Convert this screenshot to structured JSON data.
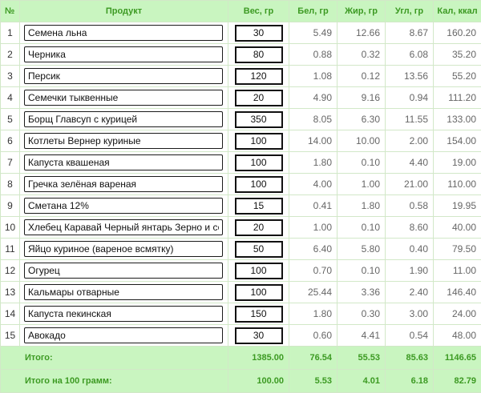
{
  "headers": {
    "num": "№",
    "product": "Продукт",
    "weight": "Вес, гр",
    "protein": "Бел, гр",
    "fat": "Жир, гр",
    "carbs": "Угл, гр",
    "kcal": "Кал, ккал"
  },
  "rows": [
    {
      "n": "1",
      "name": "Семена льна",
      "weight": "30",
      "protein": "5.49",
      "fat": "12.66",
      "carbs": "8.67",
      "kcal": "160.20"
    },
    {
      "n": "2",
      "name": "Черника",
      "weight": "80",
      "protein": "0.88",
      "fat": "0.32",
      "carbs": "6.08",
      "kcal": "35.20"
    },
    {
      "n": "3",
      "name": "Персик",
      "weight": "120",
      "protein": "1.08",
      "fat": "0.12",
      "carbs": "13.56",
      "kcal": "55.20"
    },
    {
      "n": "4",
      "name": "Семечки тыквенные",
      "weight": "20",
      "protein": "4.90",
      "fat": "9.16",
      "carbs": "0.94",
      "kcal": "111.20"
    },
    {
      "n": "5",
      "name": "Борщ Главсуп с курицей",
      "weight": "350",
      "protein": "8.05",
      "fat": "6.30",
      "carbs": "11.55",
      "kcal": "133.00"
    },
    {
      "n": "6",
      "name": "Котлеты Вернер куриные",
      "weight": "100",
      "protein": "14.00",
      "fat": "10.00",
      "carbs": "2.00",
      "kcal": "154.00"
    },
    {
      "n": "7",
      "name": "Капуста квашеная",
      "weight": "100",
      "protein": "1.80",
      "fat": "0.10",
      "carbs": "4.40",
      "kcal": "19.00"
    },
    {
      "n": "8",
      "name": "Гречка зелёная вареная",
      "weight": "100",
      "protein": "4.00",
      "fat": "1.00",
      "carbs": "21.00",
      "kcal": "110.00"
    },
    {
      "n": "9",
      "name": "Сметана 12%",
      "weight": "15",
      "protein": "0.41",
      "fat": "1.80",
      "carbs": "0.58",
      "kcal": "19.95"
    },
    {
      "n": "10",
      "name": "Хлебец Каравай Черный янтарь Зерно и сол",
      "weight": "20",
      "protein": "1.00",
      "fat": "0.10",
      "carbs": "8.60",
      "kcal": "40.00"
    },
    {
      "n": "11",
      "name": "Яйцо куриное (вареное всмятку)",
      "weight": "50",
      "protein": "6.40",
      "fat": "5.80",
      "carbs": "0.40",
      "kcal": "79.50"
    },
    {
      "n": "12",
      "name": "Огурец",
      "weight": "100",
      "protein": "0.70",
      "fat": "0.10",
      "carbs": "1.90",
      "kcal": "11.00"
    },
    {
      "n": "13",
      "name": "Кальмары отварные",
      "weight": "100",
      "protein": "25.44",
      "fat": "3.36",
      "carbs": "2.40",
      "kcal": "146.40"
    },
    {
      "n": "14",
      "name": "Капуста пекинская",
      "weight": "150",
      "protein": "1.80",
      "fat": "0.30",
      "carbs": "3.00",
      "kcal": "24.00"
    },
    {
      "n": "15",
      "name": "Авокадо",
      "weight": "30",
      "protein": "0.60",
      "fat": "4.41",
      "carbs": "0.54",
      "kcal": "48.00"
    }
  ],
  "totals": {
    "label": "Итого:",
    "weight": "1385.00",
    "protein": "76.54",
    "fat": "55.53",
    "carbs": "85.63",
    "kcal": "1146.65"
  },
  "per100": {
    "label": "Итого на 100 грамм:",
    "weight": "100.00",
    "protein": "5.53",
    "fat": "4.01",
    "carbs": "6.18",
    "kcal": "82.79"
  },
  "colors": {
    "header_bg": "#c9f5c0",
    "header_text": "#3c9a22",
    "grid": "#d2e8c8"
  }
}
